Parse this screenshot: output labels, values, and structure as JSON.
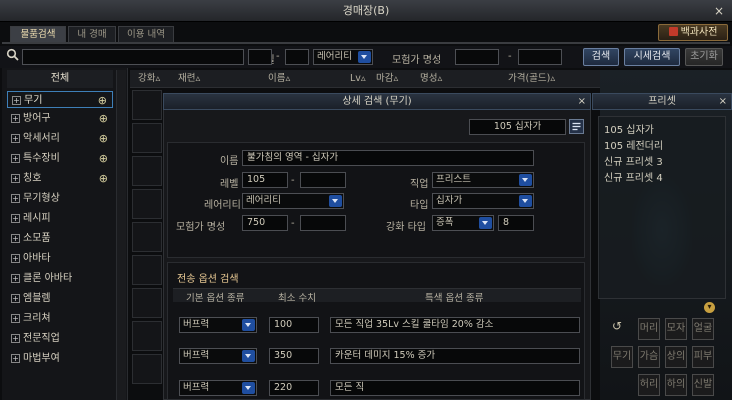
{
  "window": {
    "title": "경매장(B)",
    "close": "×"
  },
  "tabs": [
    "물품검색",
    "내 경매",
    "이용 내역"
  ],
  "dictionary_button": "백과사전",
  "search_bar": {
    "level_label": "레벨",
    "rarity_value": "레어리티",
    "adventurer_fame_label": "모험가 명성",
    "dash": "-",
    "search_button": "검색",
    "market_price_button": "시세검색",
    "reset_button": "초기화"
  },
  "categories": [
    "전체",
    "무기",
    "방어구",
    "악세서리",
    "특수장비",
    "칭호",
    "무기형상",
    "레시피",
    "소모품",
    "아바타",
    "클론 아바타",
    "엠블렘",
    "크리쳐",
    "전문직업",
    "마법부여"
  ],
  "table_headers": [
    "강화",
    "재련",
    "이름",
    "Lv",
    "마감",
    "명성",
    "가격(골드)"
  ],
  "detail_panel": {
    "title": "상세 검색 (무기)",
    "close": "×",
    "preset_value": "105 십자가",
    "name_label": "이름",
    "name_value": "불가침의 영역 - 십자가",
    "level_label": "레벨",
    "level_min": "105",
    "job_label": "직업",
    "job_value": "프리스트",
    "rarity_label": "레어리티",
    "rarity_value": "레어리티",
    "type_label": "타입",
    "type_value": "십자가",
    "fame_label": "모험가 명성",
    "fame_min": "750",
    "enhance_type_label": "강화 타입",
    "enhance_type_value": "증폭",
    "enhance_value": "8",
    "dash": "-",
    "transfer_section_title": "전송 옵션 검색",
    "col_basic": "기본 옵션 종류",
    "col_min": "최소 수치",
    "col_special": "특색 옵션 종류",
    "options": [
      {
        "type": "버프력",
        "min": "100",
        "special": "모든 직업 35Lv 스킬 쿨타임 20% 감소"
      },
      {
        "type": "버프력",
        "min": "350",
        "special": "카운터 데미지 15% 증가"
      },
      {
        "type": "버프력",
        "min": "220",
        "special": "모든 직"
      }
    ]
  },
  "preset_panel": {
    "title": "프리셋",
    "close": "×",
    "items": [
      "105 십자가",
      "105 레전더리",
      "신규 프리셋 3",
      "신규 프리셋 4"
    ]
  },
  "equip_slots": [
    "머리",
    "모자",
    "얼굴",
    "무기",
    "가슴",
    "상의",
    "피부",
    "허리",
    "하의",
    "신발"
  ]
}
